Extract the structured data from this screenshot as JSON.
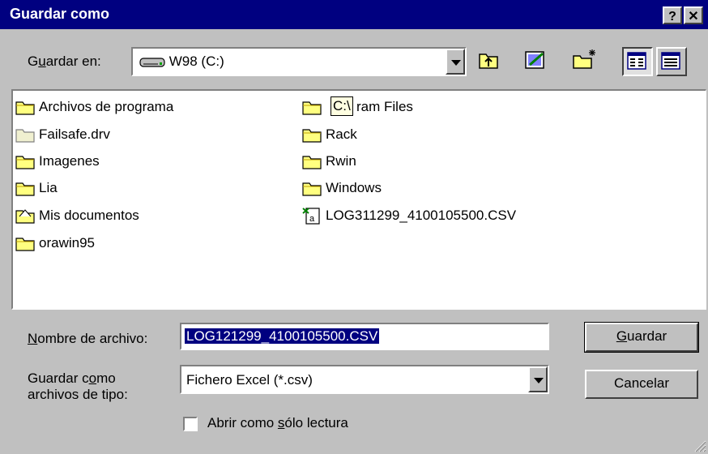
{
  "dialog": {
    "title": "Guardar como",
    "help_label": "?",
    "close_label": "✕"
  },
  "location": {
    "label_pre": "G",
    "label_u": "u",
    "label_post": "ardar en:",
    "value": "W98 (C:)"
  },
  "toolbar": {
    "up_one_level": "up-folder-icon",
    "desktop": "desktop-icon",
    "new_folder": "new-folder-icon",
    "list_view": "list-view-icon",
    "details_view": "details-view-icon"
  },
  "files": [
    {
      "name": "Archivos de programa",
      "icon": "folder-icon"
    },
    {
      "name": "Failsafe.drv",
      "icon": "folder-icon"
    },
    {
      "name": "Imagenes",
      "icon": "folder-icon"
    },
    {
      "name": "Lia",
      "icon": "folder-icon"
    },
    {
      "name": "Mis documentos",
      "icon": "folder-icon"
    },
    {
      "name": "orawin95",
      "icon": "folder-icon"
    },
    {
      "name": "ram Files",
      "icon": "folder-icon"
    },
    {
      "name": "Rack",
      "icon": "folder-icon"
    },
    {
      "name": "Rwin",
      "icon": "folder-icon"
    },
    {
      "name": "Windows",
      "icon": "folder-icon"
    },
    {
      "name": "LOG311299_4100105500.CSV",
      "icon": "csv-file-icon"
    }
  ],
  "tooltip": "C:\\",
  "filename": {
    "label_u": "N",
    "label_post": "ombre de archivo:",
    "value": "LOG121299_4100105500.CSV"
  },
  "filetype": {
    "label_line1_pre": "Guardar c",
    "label_line1_u": "o",
    "label_line1_post": "mo",
    "label_line2": "archivos de tipo:",
    "value": "Fichero Excel (*.csv)"
  },
  "readonly": {
    "label_pre": "Abrir como ",
    "label_u": "s",
    "label_post": "ólo lectura",
    "checked": false
  },
  "buttons": {
    "save_u": "G",
    "save_post": "uardar",
    "cancel": "Cancelar"
  }
}
